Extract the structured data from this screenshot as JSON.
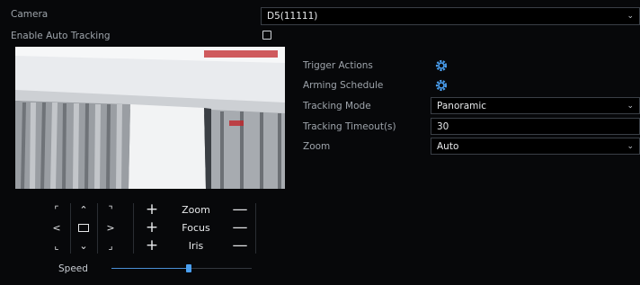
{
  "camera": {
    "label": "Camera",
    "value": "D5(11111)"
  },
  "auto_tracking": {
    "label": "Enable Auto Tracking",
    "checked": false
  },
  "trigger_actions": {
    "label": "Trigger Actions",
    "icon": "gear-icon"
  },
  "arming_schedule": {
    "label": "Arming Schedule",
    "icon": "gear-icon"
  },
  "tracking_mode": {
    "label": "Tracking Mode",
    "value": "Panoramic"
  },
  "tracking_timeout": {
    "label": "Tracking Timeout(s)",
    "value": "30"
  },
  "zoom": {
    "label": "Zoom",
    "value": "Auto"
  },
  "ptz": {
    "zoom_label": "Zoom",
    "focus_label": "Focus",
    "iris_label": "Iris",
    "speed_label": "Speed",
    "speed_level": 0.55
  },
  "colors": {
    "accent": "#4a9ff0",
    "background": "#07080a",
    "field_border": "#3a3f46"
  }
}
